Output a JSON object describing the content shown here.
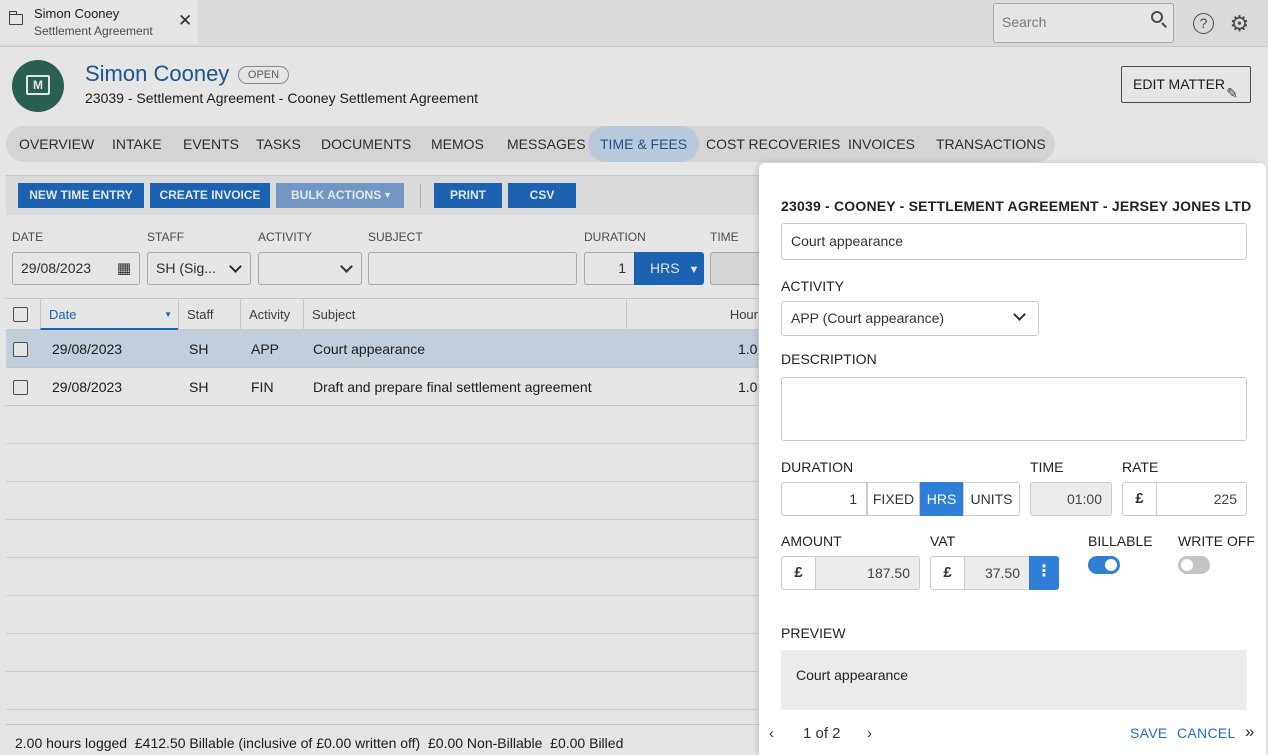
{
  "doc_tab": {
    "title": "Simon Cooney",
    "subtitle": "Settlement Agreement",
    "close": "✕"
  },
  "search": {
    "placeholder": "Search"
  },
  "header": {
    "name": "Simon Cooney",
    "status": "OPEN",
    "subtitle": "23039 - Settlement Agreement - Cooney Settlement Agreement",
    "edit_label": "EDIT MATTER"
  },
  "tabs": [
    "OVERVIEW",
    "INTAKE",
    "EVENTS",
    "TASKS",
    "DOCUMENTS",
    "MEMOS",
    "MESSAGES",
    "TIME & FEES",
    "COST RECOVERIES",
    "INVOICES",
    "TRANSACTIONS"
  ],
  "active_tab": "TIME & FEES",
  "toolbar": {
    "new_time_entry": "NEW TIME ENTRY",
    "create_invoice": "CREATE INVOICE",
    "bulk_actions": "BULK ACTIONS",
    "print": "PRINT",
    "csv": "CSV"
  },
  "filters": {
    "date_label": "DATE",
    "date_value": "29/08/2023",
    "staff_label": "STAFF",
    "staff_value": "SH (Sig...",
    "activity_label": "ACTIVITY",
    "subject_label": "SUBJECT",
    "duration_label": "DURATION",
    "duration_value": "1",
    "duration_unit": "HRS",
    "time_label": "TIME"
  },
  "grid": {
    "columns": [
      "Date",
      "Staff",
      "Activity",
      "Subject",
      "Hour"
    ],
    "rows": [
      {
        "date": "29/08/2023",
        "staff": "SH",
        "activity": "APP",
        "subject": "Court appearance",
        "hours": "1.0"
      },
      {
        "date": "29/08/2023",
        "staff": "SH",
        "activity": "FIN",
        "subject": "Draft and prepare final settlement agreement",
        "hours": "1.0"
      }
    ]
  },
  "footer": {
    "summary": "2.00 hours logged  £412.50 Billable (inclusive of £0.00 written off)  £0.00 Non-Billable  £0.00 Billed"
  },
  "panel": {
    "title": "23039 - COONEY - SETTLEMENT AGREEMENT - JERSEY JONES LTD",
    "subject_value": "Court appearance",
    "activity_label": "ACTIVITY",
    "activity_value": "APP (Court appearance)",
    "description_label": "DESCRIPTION",
    "duration_label": "DURATION",
    "duration_value": "1",
    "seg_fixed": "FIXED",
    "seg_hrs": "HRS",
    "seg_units": "UNITS",
    "time_label": "TIME",
    "time_value": "01:00",
    "rate_label": "RATE",
    "rate_value": "225",
    "currency": "£",
    "amount_label": "AMOUNT",
    "amount_value": "187.50",
    "vat_label": "VAT",
    "vat_value": "37.50",
    "billable_label": "BILLABLE",
    "billable_on": true,
    "writeoff_label": "WRITE OFF",
    "writeoff_on": false,
    "preview_label": "PREVIEW",
    "preview_text": "Court appearance",
    "pager": "1 of 2",
    "save": "SAVE",
    "cancel": "CANCEL"
  },
  "colors": {
    "accent": "#1f6fc6",
    "toggle_on": "#2f7fd9",
    "avatar": "#2f6a5e"
  }
}
